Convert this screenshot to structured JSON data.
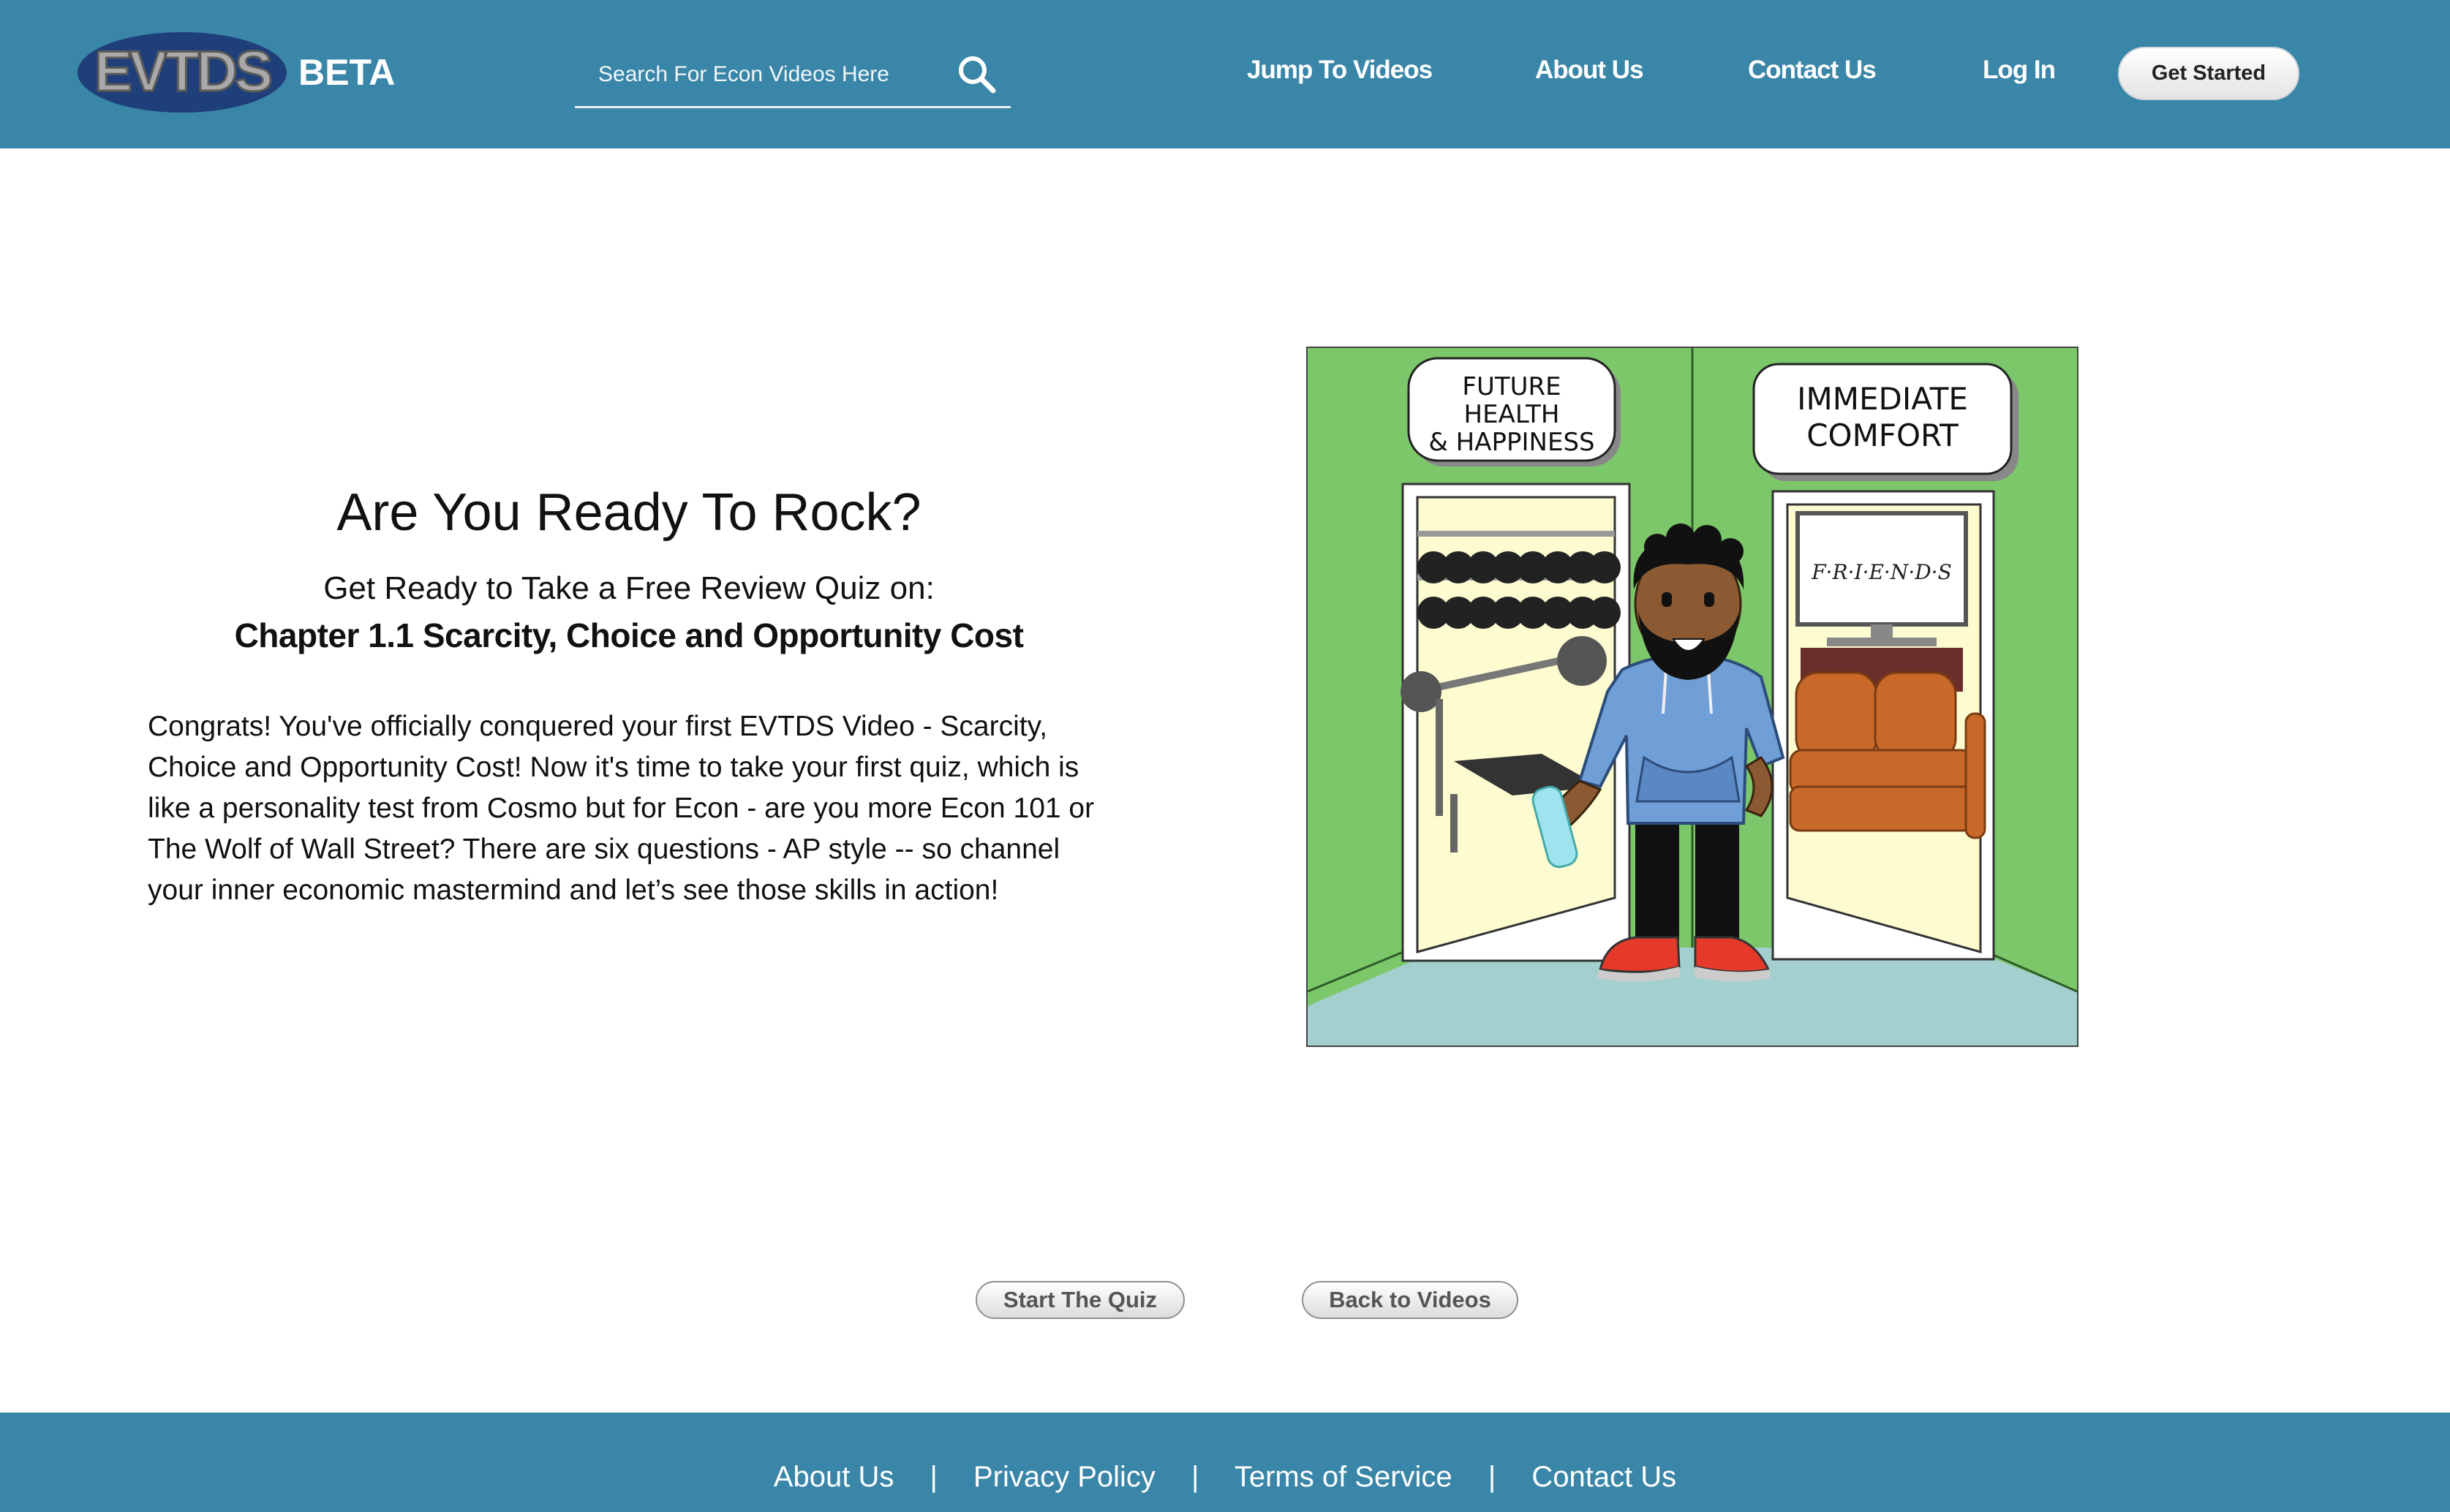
{
  "header": {
    "logo_text": "EVTDS",
    "beta_label": "BETA",
    "search_placeholder": "Search For Econ Videos Here",
    "nav": [
      "Jump To Videos",
      "About Us",
      "Contact Us",
      "Log In"
    ],
    "cta_label": "Get Started"
  },
  "main": {
    "title": "Are You Ready To Rock?",
    "subtitle": "Get Ready to Take a Free Review Quiz on:",
    "chapter": "Chapter 1.1 Scarcity, Choice and Opportunity Cost",
    "body_lines": [
      "Congrats! You've officially conquered your first EVTDS Video - Scarcity,",
      "Choice and Opportunity Cost! Now it's time to take your first quiz, which is",
      "like a personality test from Cosmo but for Econ - are you more Econ 101 or",
      "The Wolf of Wall Street? There are six questions - AP style -- so channel",
      "your inner economic mastermind and let’s see those skills in action!"
    ],
    "illustration": {
      "left_sign_lines": [
        "FUTURE",
        "HEALTH",
        "& HAPPINESS"
      ],
      "right_sign_lines": [
        "IMMEDIATE",
        "COMFORT"
      ],
      "tv_text": "F·R·I·E·N·D·S"
    },
    "start_button": "Start The Quiz",
    "back_button": "Back to Videos"
  },
  "footer": {
    "links": [
      "About Us",
      "Privacy Policy",
      "Terms of Service",
      "Contact Us"
    ],
    "separator": "|"
  },
  "colors": {
    "header_bg": "#3a86a8",
    "wall_green": "#7cc76a",
    "floor": "#a3cfcf",
    "hoodie": "#6f9fd6",
    "couch": "#c8692a"
  }
}
